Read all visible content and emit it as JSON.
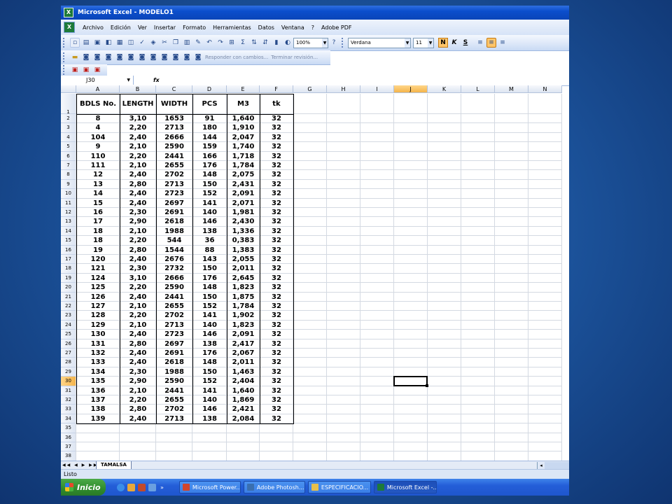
{
  "window": {
    "title": "Microsoft Excel - MODELO1"
  },
  "menu": {
    "items": [
      "Archivo",
      "Edición",
      "Ver",
      "Insertar",
      "Formato",
      "Herramientas",
      "Datos",
      "Ventana",
      "?",
      "Adobe PDF"
    ]
  },
  "toolbar": {
    "zoom": "100%",
    "font_name": "Verdana",
    "font_size": "11",
    "bold_label": "N",
    "italic_label": "K",
    "underline_label": "S",
    "review_reply": "Responder con cambios...",
    "review_end": "Terminar revisión..."
  },
  "namebox": {
    "value": "J30"
  },
  "formula": {
    "fx": "fx"
  },
  "columns": [
    "A",
    "B",
    "C",
    "D",
    "E",
    "F",
    "G",
    "H",
    "I",
    "J",
    "K",
    "L",
    "M",
    "N"
  ],
  "active_column": "J",
  "active_row": 30,
  "row_count": 38,
  "table": {
    "headers": [
      "BDLS No.",
      "LENGTH",
      "WIDTH",
      "PCS",
      "M3",
      "tk"
    ],
    "rows": [
      [
        "8",
        "3,10",
        "1653",
        "91",
        "1,640",
        "32"
      ],
      [
        "4",
        "2,20",
        "2713",
        "180",
        "1,910",
        "32"
      ],
      [
        "104",
        "2,40",
        "2666",
        "144",
        "2,047",
        "32"
      ],
      [
        "9",
        "2,10",
        "2590",
        "159",
        "1,740",
        "32"
      ],
      [
        "110",
        "2,20",
        "2441",
        "166",
        "1,718",
        "32"
      ],
      [
        "111",
        "2,10",
        "2655",
        "176",
        "1,784",
        "32"
      ],
      [
        "12",
        "2,40",
        "2702",
        "148",
        "2,075",
        "32"
      ],
      [
        "13",
        "2,80",
        "2713",
        "150",
        "2,431",
        "32"
      ],
      [
        "14",
        "2,40",
        "2723",
        "152",
        "2,091",
        "32"
      ],
      [
        "15",
        "2,40",
        "2697",
        "141",
        "2,071",
        "32"
      ],
      [
        "16",
        "2,30",
        "2691",
        "140",
        "1,981",
        "32"
      ],
      [
        "17",
        "2,90",
        "2618",
        "146",
        "2,430",
        "32"
      ],
      [
        "18",
        "2,10",
        "1988",
        "138",
        "1,336",
        "32"
      ],
      [
        "18",
        "2,20",
        "544",
        "36",
        "0,383",
        "32"
      ],
      [
        "19",
        "2,80",
        "1544",
        "88",
        "1,383",
        "32"
      ],
      [
        "120",
        "2,40",
        "2676",
        "143",
        "2,055",
        "32"
      ],
      [
        "121",
        "2,30",
        "2732",
        "150",
        "2,011",
        "32"
      ],
      [
        "124",
        "3,10",
        "2666",
        "176",
        "2,645",
        "32"
      ],
      [
        "125",
        "2,20",
        "2590",
        "148",
        "1,823",
        "32"
      ],
      [
        "126",
        "2,40",
        "2441",
        "150",
        "1,875",
        "32"
      ],
      [
        "127",
        "2,10",
        "2655",
        "152",
        "1,784",
        "32"
      ],
      [
        "128",
        "2,20",
        "2702",
        "141",
        "1,902",
        "32"
      ],
      [
        "129",
        "2,10",
        "2713",
        "140",
        "1,823",
        "32"
      ],
      [
        "130",
        "2,40",
        "2723",
        "146",
        "2,091",
        "32"
      ],
      [
        "131",
        "2,80",
        "2697",
        "138",
        "2,417",
        "32"
      ],
      [
        "132",
        "2,40",
        "2691",
        "176",
        "2,067",
        "32"
      ],
      [
        "133",
        "2,40",
        "2618",
        "148",
        "2,011",
        "32"
      ],
      [
        "134",
        "2,30",
        "1988",
        "150",
        "1,463",
        "32"
      ],
      [
        "135",
        "2,90",
        "2590",
        "152",
        "2,404",
        "32"
      ],
      [
        "136",
        "2,10",
        "2441",
        "141",
        "1,640",
        "32"
      ],
      [
        "137",
        "2,20",
        "2655",
        "140",
        "1,869",
        "32"
      ],
      [
        "138",
        "2,80",
        "2702",
        "146",
        "2,421",
        "32"
      ],
      [
        "139",
        "2,40",
        "2713",
        "138",
        "2,084",
        "32"
      ]
    ]
  },
  "sheet": {
    "tab": "TAMALSA"
  },
  "status": {
    "text": "Listo"
  },
  "taskbar": {
    "start": "Inicio",
    "tasks": [
      {
        "label": "Microsoft Power...",
        "color": "#d2452c"
      },
      {
        "label": "Adobe Photosh...",
        "color": "#3a6fb0"
      },
      {
        "label": "ESPECIFICACIO...",
        "color": "#e8c04a"
      },
      {
        "label": "Microsoft Excel -...",
        "color": "#1d7a3a"
      }
    ]
  }
}
